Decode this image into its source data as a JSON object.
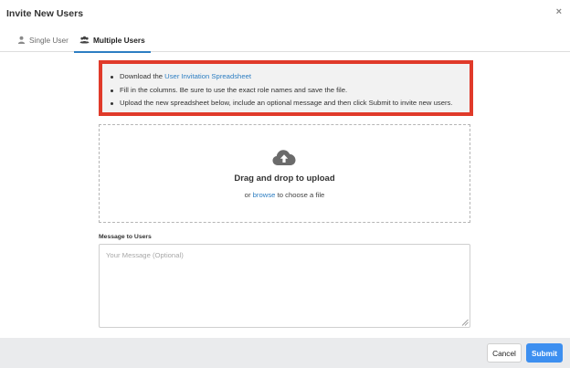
{
  "modal": {
    "title": "Invite New Users",
    "close_symbol": "×"
  },
  "tabs": [
    {
      "label": "Single User",
      "icon": "user-icon",
      "active": false
    },
    {
      "label": "Multiple Users",
      "icon": "users-icon",
      "active": true
    }
  ],
  "instructions": {
    "items": [
      {
        "text": "Download the ",
        "link": "User Invitation Spreadsheet"
      },
      {
        "text": "Fill in the columns. Be sure to use the exact role names and save the file."
      },
      {
        "text": "Upload the new spreadsheet below, include an optional message and then click Submit to invite new users."
      }
    ],
    "highlight_color": "#e03a2a"
  },
  "upload": {
    "icon": "cloud-upload-icon",
    "title": "Drag and drop to upload",
    "prefix": "or ",
    "browse_link": "browse",
    "suffix": " to choose a file"
  },
  "message": {
    "label": "Message to Users",
    "placeholder": "Your Message (Optional)",
    "value": ""
  },
  "footer": {
    "cancel_label": "Cancel",
    "submit_label": "Submit",
    "submit_color": "#3d8ff0"
  }
}
